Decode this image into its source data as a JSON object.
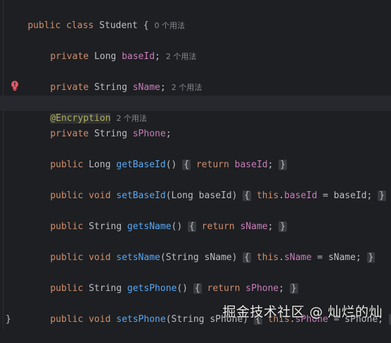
{
  "class_decl": {
    "kw_public": "public",
    "kw_class": "class",
    "name": "Student",
    "brace": "{",
    "usages": "0 个用法"
  },
  "field_baseId": {
    "kw": "private",
    "type": "Long",
    "name": "baseId",
    "semi": ";",
    "usages": "2 个用法"
  },
  "field_sName": {
    "kw": "private",
    "type": "String",
    "name": "sName",
    "semi": ";",
    "usages": "2 个用法"
  },
  "annotation": {
    "text": "@Encryption",
    "usages": "2 个用法"
  },
  "field_sPhone": {
    "kw": "private",
    "type": "String",
    "name": "sPhone",
    "semi": ";"
  },
  "methods": [
    {
      "kw": "public",
      "ret": "Long",
      "name": "getBaseId",
      "params": "()",
      "body_kw": "return",
      "body_field": "baseId",
      "body_rest": ";"
    },
    {
      "kw": "public",
      "ret": "void",
      "name": "setBaseId",
      "params": "(Long baseId)",
      "body_kw": "this",
      "body_field": "baseId",
      "body_rest": " = baseId;"
    },
    {
      "kw": "public",
      "ret": "String",
      "name": "getsName",
      "params": "()",
      "body_kw": "return",
      "body_field": "sName",
      "body_rest": ";"
    },
    {
      "kw": "public",
      "ret": "void",
      "name": "setsName",
      "params": "(String sName)",
      "body_kw": "this",
      "body_field": "sName",
      "body_rest": " = sName;"
    },
    {
      "kw": "public",
      "ret": "String",
      "name": "getsPhone",
      "params": "()",
      "body_kw": "return",
      "body_field": "sPhone",
      "body_rest": ";"
    },
    {
      "kw": "public",
      "ret": "void",
      "name": "setsPhone",
      "params": "(String sPhone)",
      "body_kw": "this",
      "body_field": "sPhone",
      "body_rest": " = sPhone;"
    }
  ],
  "closing_brace": "}",
  "fold_open": "{",
  "fold_close": "}",
  "watermark": "掘金技术社区 @ 灿烂的灿"
}
